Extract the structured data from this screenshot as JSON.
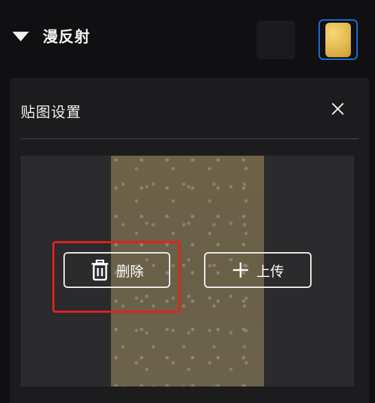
{
  "section": {
    "title": "漫反射"
  },
  "dialog": {
    "title": "贴图设置",
    "delete_label": "删除",
    "upload_label": "上传"
  },
  "colors": {
    "background": "#101012",
    "panel": "#1c1c1e",
    "selection_border": "#1f6fd6",
    "highlight": "#e3221b"
  },
  "icons": [
    "caret-down-icon",
    "close-icon",
    "trash-icon",
    "plus-icon"
  ]
}
